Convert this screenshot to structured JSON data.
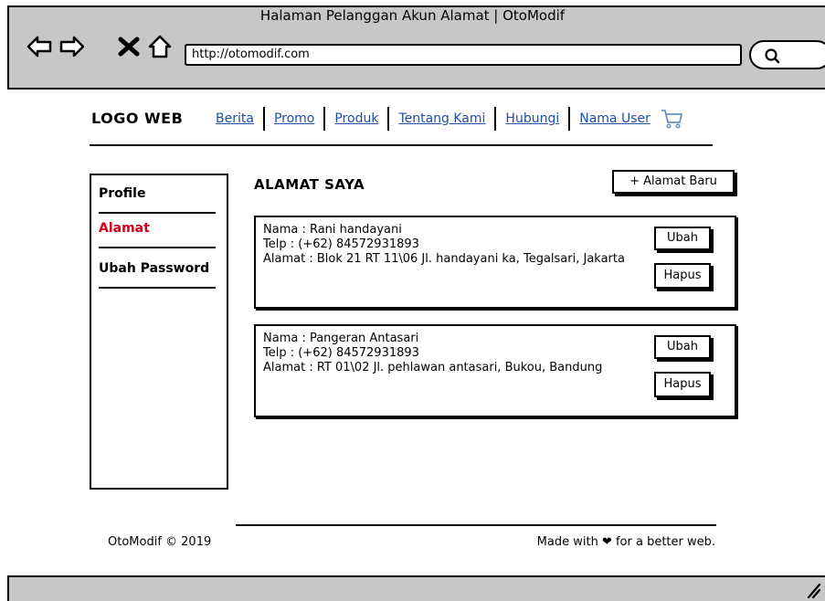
{
  "window": {
    "title": "Halaman Pelanggan Akun Alamat | OtoModif",
    "url": "http://otomodif.com",
    "nav_icons": [
      "back-arrow-icon",
      "forward-arrow-icon",
      "close-x-icon",
      "home-icon"
    ],
    "search_icon": "search-icon"
  },
  "header": {
    "logo": "LOGO WEB",
    "links": [
      "Berita",
      "Promo",
      "Produk",
      "Tentang Kami",
      "Hubungi",
      "Nama User"
    ],
    "cart_icon": "shopping-cart-icon",
    "link_color": "#1f4fa3"
  },
  "sidebar": {
    "items": [
      {
        "label": "Profile",
        "active": false
      },
      {
        "label": "Alamat",
        "active": true
      },
      {
        "label": "Ubah Password",
        "active": false
      }
    ],
    "active_color": "#d0021b"
  },
  "main": {
    "title": "ALAMAT SAYA",
    "add_button": "+ Alamat Baru",
    "addresses": [
      {
        "name": "Nama : Rani handayani",
        "phone": "Telp : (+62) 84572931893",
        "address": "Alamat : Blok 21 RT 11\\06 Jl. handayani ka, Tegalsari, Jakarta",
        "edit_label": "Ubah",
        "delete_label": "Hapus"
      },
      {
        "name": "Nama : Pangeran Antasari",
        "phone": "Telp : (+62) 84572931893",
        "address": "Alamat : RT 01\\02 Jl. pehlawan antasari, Bukou, Bandung",
        "edit_label": "Ubah",
        "delete_label": "Hapus"
      }
    ]
  },
  "footer": {
    "copyright": "OtoModif © 2019",
    "tagline": "Made with ❤ for a better web."
  }
}
